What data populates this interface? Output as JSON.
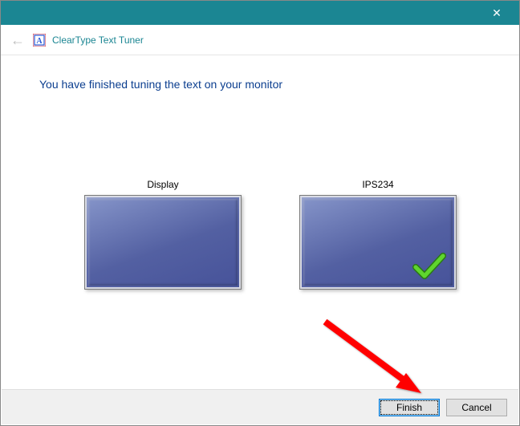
{
  "window": {
    "title": "ClearType Text Tuner"
  },
  "content": {
    "headline": "You have finished tuning the text on your monitor",
    "monitors": {
      "left_label": "Display",
      "right_label": "IPS234"
    }
  },
  "footer": {
    "primary": "Finish",
    "secondary": "Cancel"
  }
}
